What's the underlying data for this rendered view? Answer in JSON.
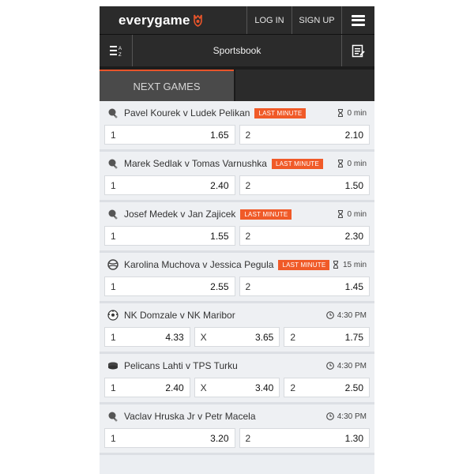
{
  "header": {
    "brand": "everygame",
    "login_label": "LOG IN",
    "signup_label": "SIGN UP",
    "menu_icon": "hamburger-icon"
  },
  "subheader": {
    "title": "Sportsbook",
    "left_icon": "sort-az-icon",
    "right_icon": "betslip-icon"
  },
  "tabs": [
    {
      "label": "NEXT GAMES",
      "active": true
    },
    {
      "label": "",
      "active": false
    }
  ],
  "colors": {
    "accent": "#e8542a",
    "badge": "#f05a28",
    "bar": "#2b2b2b"
  },
  "games": [
    {
      "sport_icon": "tennis-icon",
      "name": "Pavel Kourek v Ludek Pelikan",
      "badge": "LAST MINUTE",
      "time_icon": "hourglass-icon",
      "time": "0 min",
      "odds": [
        {
          "label": "1",
          "value": "1.65"
        },
        {
          "label": "2",
          "value": "2.10"
        }
      ]
    },
    {
      "sport_icon": "tennis-icon",
      "name": "Marek Sedlak v Tomas Varnushka",
      "badge": "LAST MINUTE",
      "time_icon": "hourglass-icon",
      "time": "0 min",
      "odds": [
        {
          "label": "1",
          "value": "2.40"
        },
        {
          "label": "2",
          "value": "1.50"
        }
      ]
    },
    {
      "sport_icon": "tennis-icon",
      "name": "Josef Medek v Jan Zajicek",
      "badge": "LAST MINUTE",
      "time_icon": "hourglass-icon",
      "time": "0 min",
      "odds": [
        {
          "label": "1",
          "value": "1.55"
        },
        {
          "label": "2",
          "value": "2.30"
        }
      ]
    },
    {
      "sport_icon": "tennis-ball-icon",
      "name": "Karolina Muchova v Jessica Pegula",
      "badge": "LAST MINUTE",
      "time_icon": "hourglass-icon",
      "time": "15 min",
      "odds": [
        {
          "label": "1",
          "value": "2.55"
        },
        {
          "label": "2",
          "value": "1.45"
        }
      ]
    },
    {
      "sport_icon": "soccer-ball-icon",
      "name": "NK Domzale v NK Maribor",
      "badge": "",
      "time_icon": "clock-icon",
      "time": "4:30 PM",
      "odds": [
        {
          "label": "1",
          "value": "4.33"
        },
        {
          "label": "X",
          "value": "3.65"
        },
        {
          "label": "2",
          "value": "1.75"
        }
      ]
    },
    {
      "sport_icon": "hockey-puck-icon",
      "name": "Pelicans Lahti v TPS Turku",
      "badge": "",
      "time_icon": "clock-icon",
      "time": "4:30 PM",
      "odds": [
        {
          "label": "1",
          "value": "2.40"
        },
        {
          "label": "X",
          "value": "3.40"
        },
        {
          "label": "2",
          "value": "2.50"
        }
      ]
    },
    {
      "sport_icon": "tennis-icon",
      "name": "Vaclav Hruska Jr v Petr Macela",
      "badge": "",
      "time_icon": "clock-icon",
      "time": "4:30 PM",
      "odds": [
        {
          "label": "1",
          "value": "3.20"
        },
        {
          "label": "2",
          "value": "1.30"
        }
      ]
    }
  ]
}
